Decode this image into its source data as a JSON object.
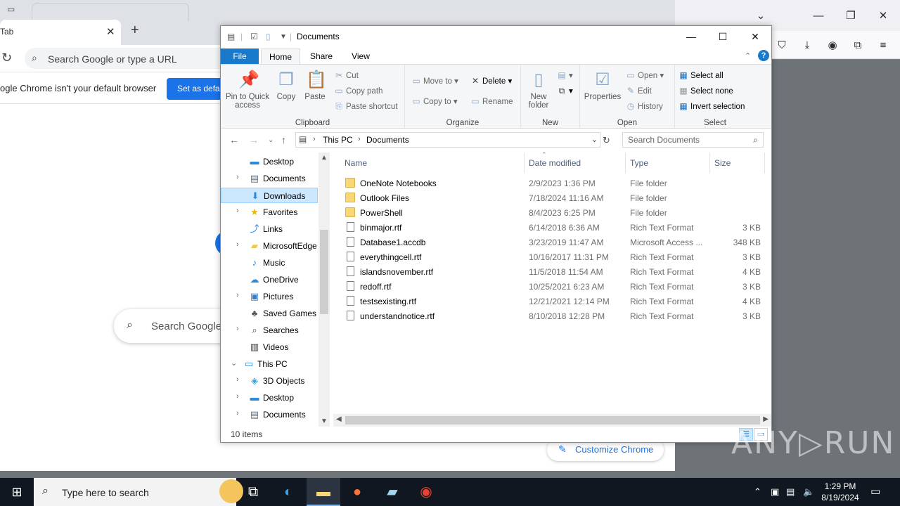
{
  "chrome": {
    "tab_title": "Tab",
    "omnibox_placeholder": "Search Google or type a URL",
    "infobar_message": "ogle Chrome isn't your default browser",
    "infobar_button": "Set as defau",
    "search_placeholder": "Search Google",
    "customize_label": "Customize Chrome"
  },
  "explorer": {
    "title": "Documents",
    "ribbon_tabs": [
      "File",
      "Home",
      "Share",
      "View"
    ],
    "ribbon": {
      "clipboard": {
        "label": "Clipboard",
        "pin": "Pin to Quick access",
        "copy": "Copy",
        "paste": "Paste",
        "cut": "Cut",
        "copy_path": "Copy path",
        "paste_shortcut": "Paste shortcut"
      },
      "organize": {
        "label": "Organize",
        "move_to": "Move to",
        "copy_to": "Copy to",
        "delete": "Delete",
        "rename": "Rename"
      },
      "new": {
        "label": "New",
        "new_folder": "New folder"
      },
      "open": {
        "label": "Open",
        "properties": "Properties",
        "open": "Open",
        "edit": "Edit",
        "history": "History"
      },
      "select": {
        "label": "Select",
        "select_all": "Select all",
        "select_none": "Select none",
        "invert": "Invert selection"
      }
    },
    "breadcrumb": [
      "This PC",
      "Documents"
    ],
    "search_placeholder": "Search Documents",
    "tree": [
      {
        "label": "Desktop",
        "icon": "desktop-icon",
        "chev": ""
      },
      {
        "label": "Documents",
        "icon": "documents-icon",
        "chev": "›"
      },
      {
        "label": "Downloads",
        "icon": "downloads-icon",
        "chev": "",
        "selected": true
      },
      {
        "label": "Favorites",
        "icon": "favorites-icon",
        "chev": "›"
      },
      {
        "label": "Links",
        "icon": "links-icon",
        "chev": ""
      },
      {
        "label": "MicrosoftEdge",
        "icon": "folder-icon",
        "chev": "›"
      },
      {
        "label": "Music",
        "icon": "music-icon",
        "chev": ""
      },
      {
        "label": "OneDrive",
        "icon": "onedrive-icon",
        "chev": ""
      },
      {
        "label": "Pictures",
        "icon": "pictures-icon",
        "chev": "›"
      },
      {
        "label": "Saved Games",
        "icon": "saved-games-icon",
        "chev": ""
      },
      {
        "label": "Searches",
        "icon": "searches-icon",
        "chev": "›"
      },
      {
        "label": "Videos",
        "icon": "videos-icon",
        "chev": ""
      },
      {
        "label": "This PC",
        "icon": "this-pc-icon",
        "chev": "⌄",
        "level": 0
      },
      {
        "label": "3D Objects",
        "icon": "3d-objects-icon",
        "chev": "›"
      },
      {
        "label": "Desktop",
        "icon": "desktop-icon",
        "chev": "›"
      },
      {
        "label": "Documents",
        "icon": "documents-icon",
        "chev": "›"
      }
    ],
    "columns": [
      "Name",
      "Date modified",
      "Type",
      "Size"
    ],
    "files": [
      {
        "name": "OneNote Notebooks",
        "date": "2/9/2023 1:36 PM",
        "type": "File folder",
        "size": "",
        "kind": "folder"
      },
      {
        "name": "Outlook Files",
        "date": "7/18/2024 11:16 AM",
        "type": "File folder",
        "size": "",
        "kind": "folder"
      },
      {
        "name": "PowerShell",
        "date": "8/4/2023 6:25 PM",
        "type": "File folder",
        "size": "",
        "kind": "folder"
      },
      {
        "name": "binmajor.rtf",
        "date": "6/14/2018 6:36 AM",
        "type": "Rich Text Format",
        "size": "3 KB",
        "kind": "doc"
      },
      {
        "name": "Database1.accdb",
        "date": "3/23/2019 11:47 AM",
        "type": "Microsoft Access ...",
        "size": "348 KB",
        "kind": "doc"
      },
      {
        "name": "everythingcell.rtf",
        "date": "10/16/2017 11:31 PM",
        "type": "Rich Text Format",
        "size": "3 KB",
        "kind": "doc"
      },
      {
        "name": "islandsnovember.rtf",
        "date": "11/5/2018 11:54 AM",
        "type": "Rich Text Format",
        "size": "4 KB",
        "kind": "doc"
      },
      {
        "name": "redoff.rtf",
        "date": "10/25/2021 6:23 AM",
        "type": "Rich Text Format",
        "size": "3 KB",
        "kind": "doc"
      },
      {
        "name": "testsexisting.rtf",
        "date": "12/21/2021 12:14 PM",
        "type": "Rich Text Format",
        "size": "4 KB",
        "kind": "doc"
      },
      {
        "name": "understandnotice.rtf",
        "date": "8/10/2018 12:28 PM",
        "type": "Rich Text Format",
        "size": "3 KB",
        "kind": "doc"
      }
    ],
    "status": "10 items"
  },
  "taskbar": {
    "search_placeholder": "Type here to search",
    "time": "1:29 PM",
    "date": "8/19/2024"
  },
  "watermark": "ANY▷RUN"
}
